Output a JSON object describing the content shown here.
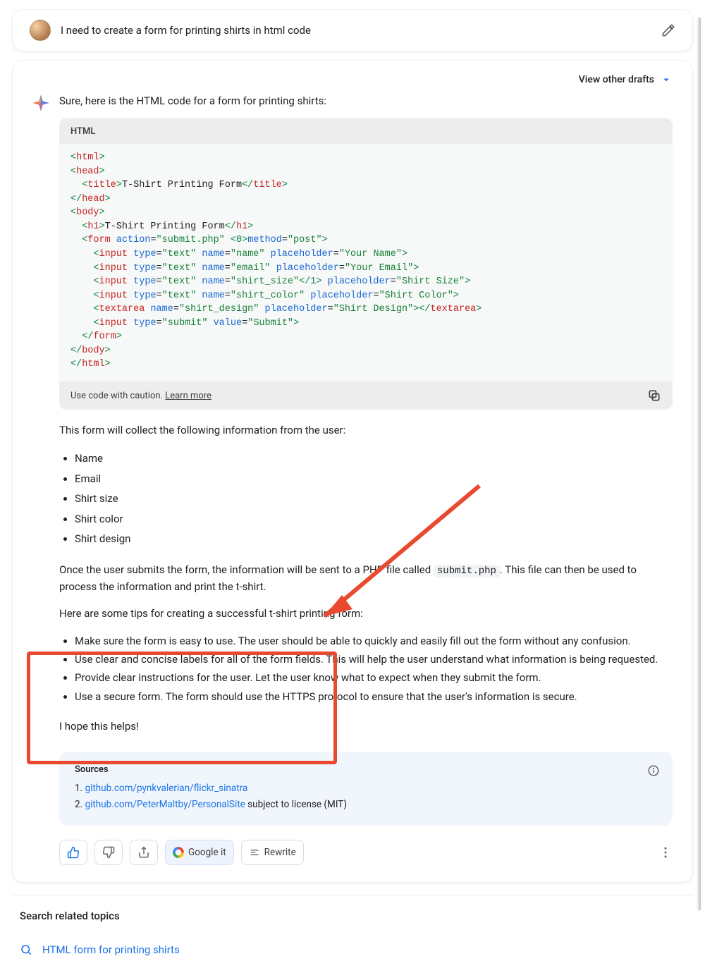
{
  "user": {
    "prompt": "I need to create a form for printing shirts in html code"
  },
  "drafts": {
    "view_label": "View other drafts"
  },
  "response": {
    "intro": "Sure, here is the HTML code for a form for printing shirts:",
    "code_lang": "HTML",
    "code_caution": "Use code with caution.",
    "code_learn": "Learn more",
    "collect_para": "This form will collect the following information from the user:",
    "fields": [
      "Name",
      "Email",
      "Shirt size",
      "Shirt color",
      "Shirt design"
    ],
    "submit_para_1": "Once the user submits the form, the information will be sent to a PHP file called ",
    "submit_code": "submit.php",
    "submit_para_2": ". This file can then be used to process the information and print the t-shirt.",
    "tips_intro": "Here are some tips for creating a successful t-shirt printing form:",
    "tips": [
      "Make sure the form is easy to use. The user should be able to quickly and easily fill out the form without any confusion.",
      "Use clear and concise labels for all of the form fields. This will help the user understand what information is being requested.",
      "Provide clear instructions for the user. Let the user know what to expect when they submit the form.",
      "Use a secure form. The form should use the HTTPS protocol to ensure that the user's information is secure."
    ],
    "hope": "I hope this helps!"
  },
  "sources": {
    "title": "Sources",
    "items": [
      {
        "n": "1.",
        "link": "github.com/pynkvalerian/flickr_sinatra",
        "suffix": ""
      },
      {
        "n": "2.",
        "link": "github.com/PeterMaltby/PersonalSite",
        "suffix": " subject to license (MIT)"
      }
    ]
  },
  "actions": {
    "google": "Google it",
    "rewrite": "Rewrite"
  },
  "related": {
    "heading": "Search related topics",
    "item": "HTML form for printing shirts"
  },
  "code": {
    "title_text": "T-Shirt Printing Form",
    "h1_text": "T-Shirt Printing Form",
    "action": "submit.php",
    "method": "post",
    "ph_name": "Your Name",
    "ph_email": "Your Email",
    "ph_size": "Shirt Size",
    "ph_color": "Shirt Color",
    "ph_design": "Shirt Design",
    "submit_val": "Submit"
  }
}
